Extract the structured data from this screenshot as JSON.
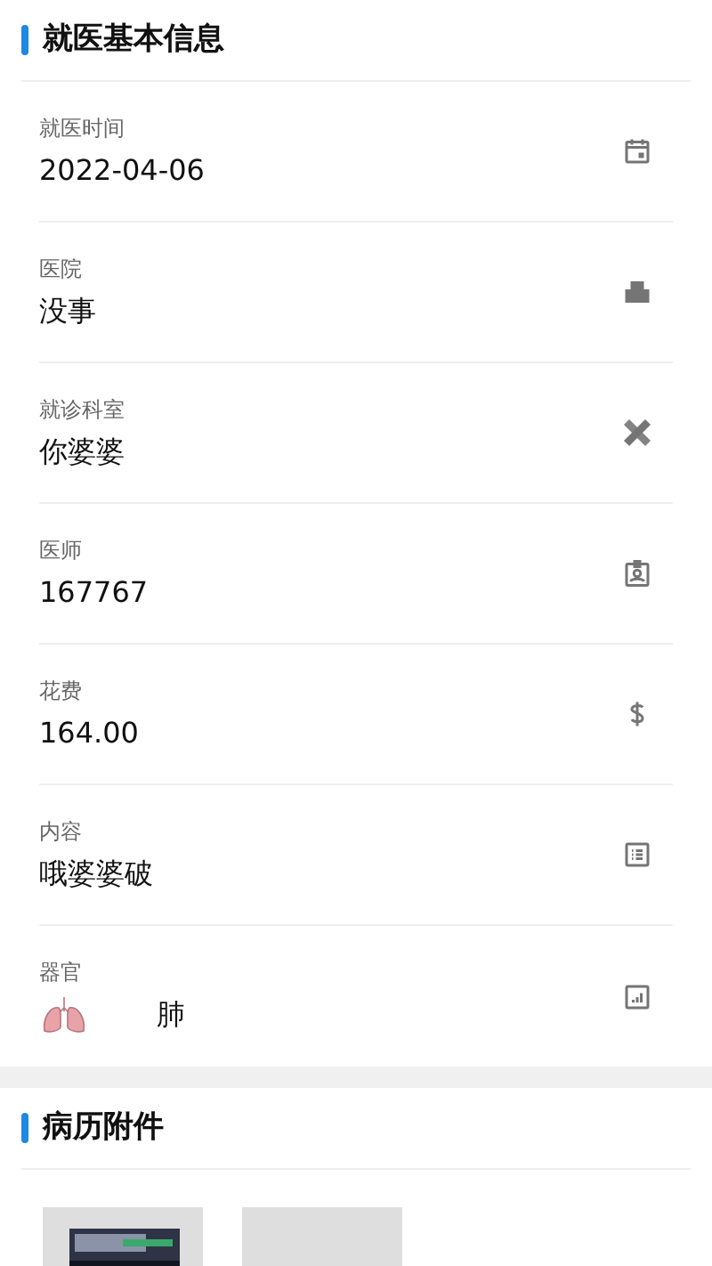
{
  "basic_info": {
    "title": "就医基本信息",
    "fields": [
      {
        "kind": "text",
        "label": "就医时间",
        "value": "2022-04-06"
      },
      {
        "kind": "text",
        "label": "医院",
        "value": "没事"
      },
      {
        "kind": "text",
        "label": "就诊科室",
        "value": "你婆婆"
      },
      {
        "kind": "text",
        "label": "医师",
        "value": "167767"
      },
      {
        "kind": "text",
        "label": "花费",
        "value": "164.00"
      },
      {
        "kind": "text",
        "label": "内容",
        "value": "哦婆婆破"
      },
      {
        "kind": "organ",
        "label": "器官",
        "value": "肺"
      }
    ]
  },
  "attachments": {
    "title": "病历附件"
  }
}
